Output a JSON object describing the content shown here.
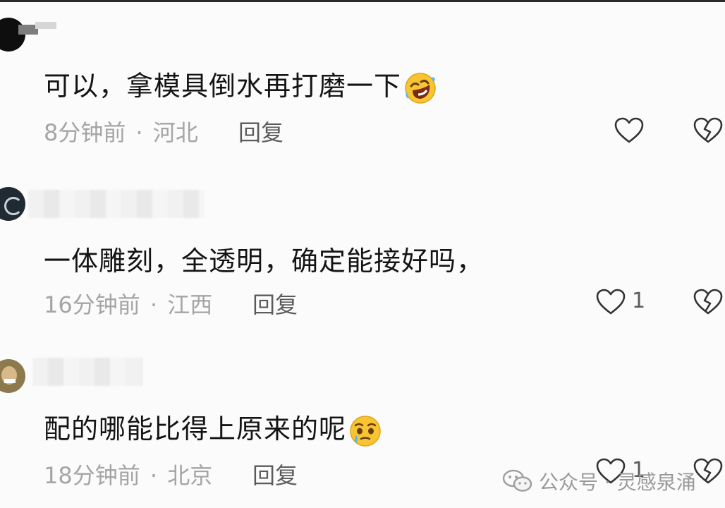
{
  "comments": [
    {
      "text": "可以，拿模具倒水再打磨一下",
      "emoji": "rolling-on-floor-laughing-emoji",
      "time": "8分钟前",
      "location": "河北",
      "reply_label": "回复",
      "likes": ""
    },
    {
      "text": "一体雕刻，全透明，确定能接好吗，",
      "emoji": "",
      "time": "16分钟前",
      "location": "江西",
      "reply_label": "回复",
      "likes": "1"
    },
    {
      "text": "配的哪能比得上原来的呢",
      "emoji": "pleading-tear-emoji",
      "time": "18分钟前",
      "location": "北京",
      "reply_label": "回复",
      "likes": "1"
    }
  ],
  "separator": "·",
  "watermark": {
    "icon": "wechat-icon",
    "text": "公众号 · 灵感泉涌"
  },
  "colors": {
    "text": "#141414",
    "meta": "#a5a5a5",
    "reply": "#5b5b5b"
  }
}
